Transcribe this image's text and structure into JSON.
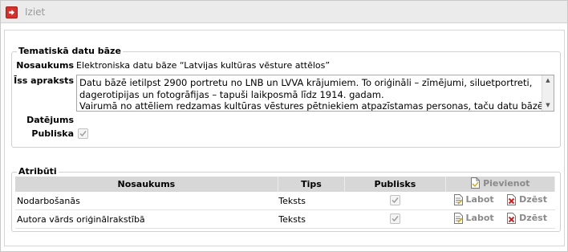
{
  "toolbar": {
    "exit_label": "Iziet"
  },
  "database": {
    "section_title": "Tematiskā datu bāze",
    "name_label": "Nosaukums",
    "name_value": "Elektroniska datu bāze “Latvijas kultūras vēsture attēlos”",
    "description_label": "Īss apraksts",
    "description_value": "Datu bāzē ietilpst 2900 portretu no LNB un LVVA krājumiem. To oriģināli – zīmējumi, siluetportreti, dagerotipijas un fotogrāfijas – tapuši laikposmā līdz 1914. gadam.\nVairumā no attēliem redzamas kultūras vēstures pētniekiem atpazīstamas personas, taču datu bāzē ir arī",
    "date_label": "Datējums",
    "date_value": "",
    "public_label": "Publiska",
    "public_checked": true
  },
  "attributes": {
    "section_title": "Atribūti",
    "columns": {
      "name": "Nosaukums",
      "type": "Tips",
      "public": "Publisks"
    },
    "add_label": "Pievienot",
    "rows": [
      {
        "name": "Nodarbošanās",
        "type": "Teksts",
        "public": true,
        "edit_label": "Labot",
        "delete_label": "Dzēst"
      },
      {
        "name": "Autora vārds oriģinālrakstībā",
        "type": "Teksts",
        "public": true,
        "edit_label": "Labot",
        "delete_label": "Dzēst"
      }
    ]
  },
  "icons": {
    "exit": "exit-arrow-icon",
    "add": "add-document-icon",
    "edit": "edit-document-icon",
    "delete": "delete-cross-icon"
  },
  "colors": {
    "toolbar_bg": "#ebebeb",
    "exit_icon": "#d9302c",
    "header_bg": "#d7d7d7",
    "delete_red": "#d21f1f"
  }
}
